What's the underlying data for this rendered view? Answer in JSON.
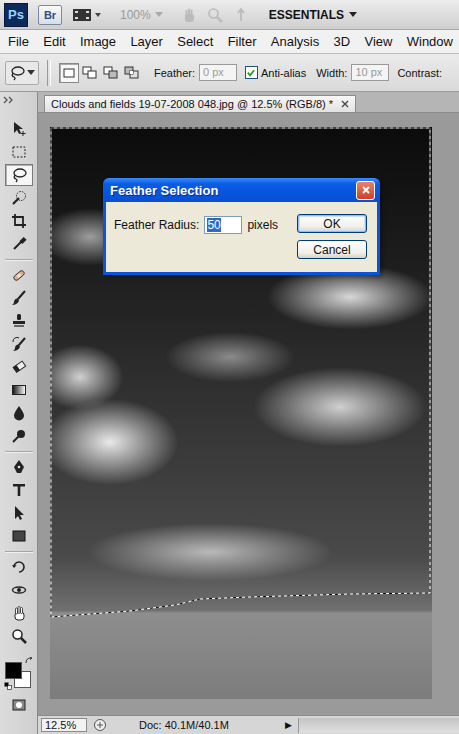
{
  "app": {
    "logo": "Ps",
    "bridge": "Br",
    "zoom": "100%",
    "zoom_disabled": true,
    "workspace": "ESSENTIALS"
  },
  "menu": [
    "File",
    "Edit",
    "Image",
    "Layer",
    "Select",
    "Filter",
    "Analysis",
    "3D",
    "View",
    "Window"
  ],
  "options": {
    "modes": [
      {
        "selected": true
      },
      {
        "selected": false
      },
      {
        "selected": false
      },
      {
        "selected": false
      }
    ],
    "feather_label": "Feather:",
    "feather_value": "0 px",
    "feather_disabled": true,
    "antialias_label": "Anti-alias",
    "antialias_checked": true,
    "width_label": "Width:",
    "width_value": "10 px",
    "width_disabled": true,
    "contrast_label": "Contrast:"
  },
  "document": {
    "tab_title": "Clouds and fields 19-07-2008 048.jpg @ 12.5% (RGB/8) *",
    "selection_active": true
  },
  "tools": [
    {
      "selected": false
    },
    {
      "selected": false
    },
    {
      "selected": true
    },
    {
      "selected": false
    },
    {
      "selected": false
    },
    {
      "selected": false
    },
    {
      "selected": false
    },
    {
      "selected": false
    },
    {
      "selected": false
    },
    {
      "selected": false
    },
    {
      "selected": false
    },
    {
      "selected": false
    },
    {
      "selected": false
    },
    {
      "selected": false
    },
    {
      "selected": false
    },
    {
      "selected": false
    },
    {
      "selected": false
    },
    {
      "selected": false
    },
    {
      "selected": false
    },
    {
      "selected": false
    },
    {
      "selected": false
    },
    {
      "selected": false
    }
  ],
  "colors": {
    "foreground": "#000000",
    "background": "#ffffff"
  },
  "dialog": {
    "title": "Feather Selection",
    "label": "Feather Radius:",
    "value": "50",
    "value_selected": true,
    "unit": "pixels",
    "buttons": [
      {
        "label": "OK",
        "default": true
      },
      {
        "label": "Cancel",
        "default": false
      }
    ]
  },
  "status_bar": {
    "zoom": "12.5%",
    "doc": "Doc: 40.1M/40.1M",
    "arrow": "▶"
  }
}
